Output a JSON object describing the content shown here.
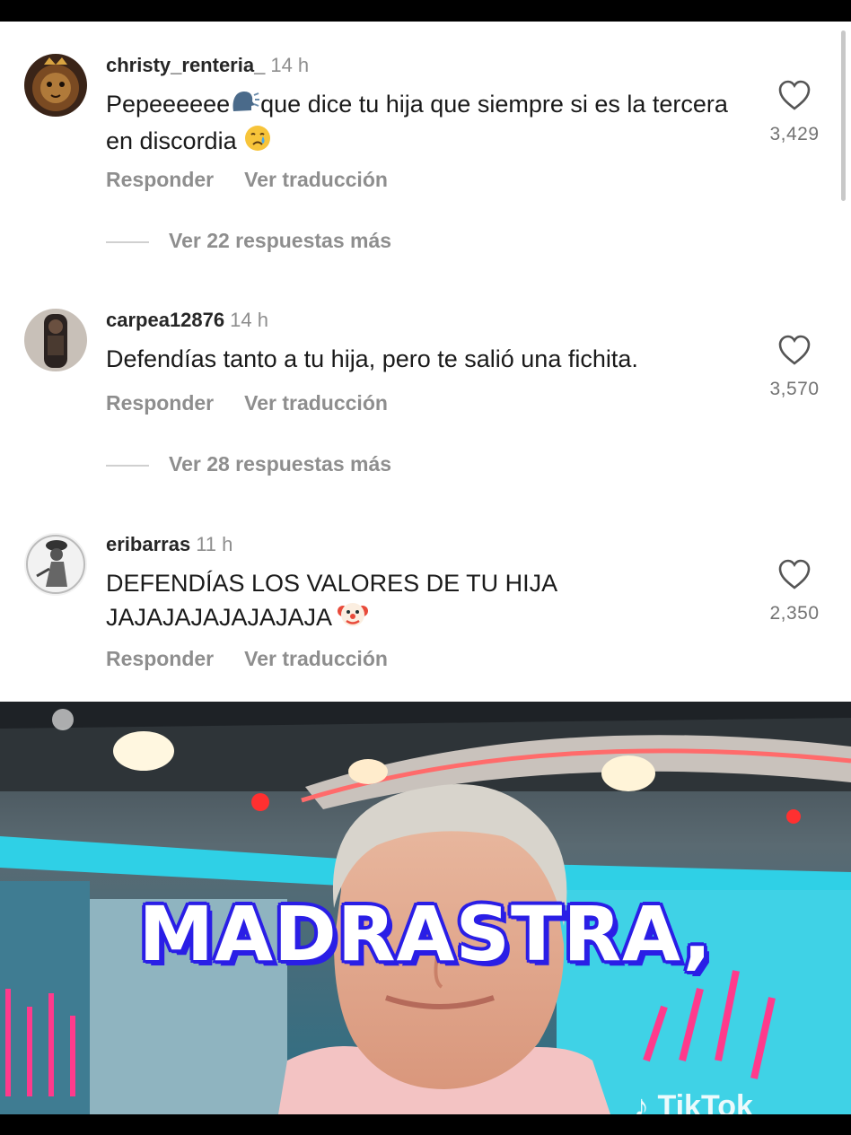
{
  "comments": [
    {
      "username": "christy_renteria_",
      "time": "14 h",
      "text_before": "Pepeeeeee",
      "text_after": "que dice tu hija que siempre si es la tercera en discordia",
      "reply_label": "Responder",
      "translate_label": "Ver traducción",
      "likes": "3,429",
      "view_replies": "Ver 22 respuestas más",
      "emoji_icons": [
        "speaking-head-icon",
        "crying-face-icon"
      ]
    },
    {
      "username": "carpea12876",
      "time": "14 h",
      "text": "Defendías tanto a tu hija, pero te salió una fichita.",
      "reply_label": "Responder",
      "translate_label": "Ver traducción",
      "likes": "3,570",
      "view_replies": "Ver 28 respuestas más"
    },
    {
      "username": "eribarras",
      "time": "11 h",
      "text_line1": "DEFENDÍAS LOS VALORES DE TU HIJA",
      "text_line2": "JAJAJAJAJAJAJAJA",
      "reply_label": "Responder",
      "translate_label": "Ver traducción",
      "likes": "2,350",
      "emoji_icons": [
        "clown-face-icon"
      ]
    }
  ],
  "video": {
    "caption": "MADRASTRA,",
    "watermark": "TikTok"
  },
  "colors": {
    "caption_outline": "#2a1ee6",
    "studio_cyan": "#2fd0e6",
    "neon_pink": "#ff3a8c"
  }
}
